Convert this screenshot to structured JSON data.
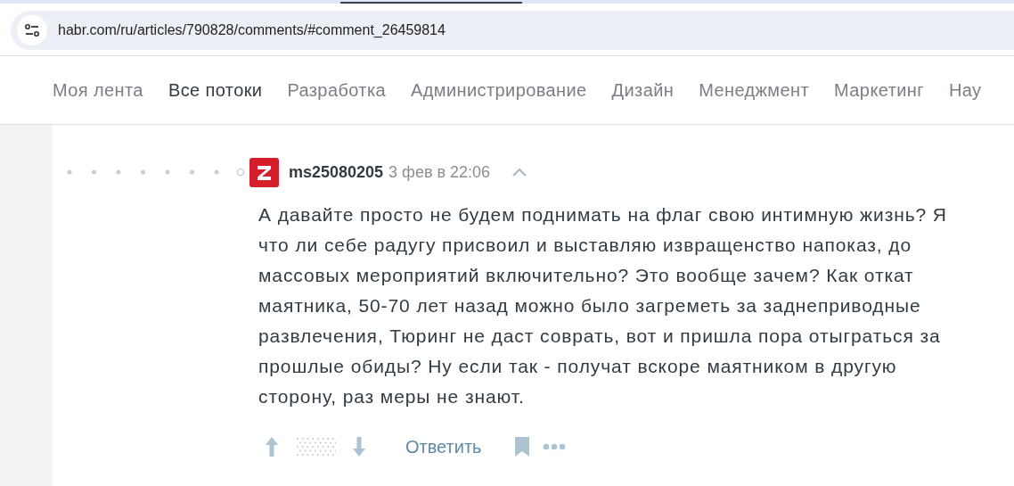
{
  "address_bar": {
    "url": "habr.com/ru/articles/790828/comments/#comment_26459814"
  },
  "nav": [
    {
      "label": "Моя лента",
      "selected": false
    },
    {
      "label": "Все потоки",
      "selected": true
    },
    {
      "label": "Разработка",
      "selected": false
    },
    {
      "label": "Администрирование",
      "selected": false
    },
    {
      "label": "Дизайн",
      "selected": false
    },
    {
      "label": "Менеджмент",
      "selected": false
    },
    {
      "label": "Маркетинг",
      "selected": false
    },
    {
      "label": "Нау",
      "selected": false
    }
  ],
  "comment": {
    "author": "ms25080205",
    "time": "3 фев в 22:06",
    "text": "А давайте просто не будем поднимать на флаг свою интимную жизнь? Я что ли себе радугу присвоил и выставляю извращенство напоказ, до массовых мероприятий включительно? Это вообще зачем? Как откат маятника, 50-70 лет назад можно было загреметь за заднеприводные развлечения, Тюринг не даст соврать, вот и пришла пора отыграться за прошлые обиды? Ну если так - получат вскоре маятником в другую сторону, раз меры не знают.",
    "reply": "Ответить"
  }
}
